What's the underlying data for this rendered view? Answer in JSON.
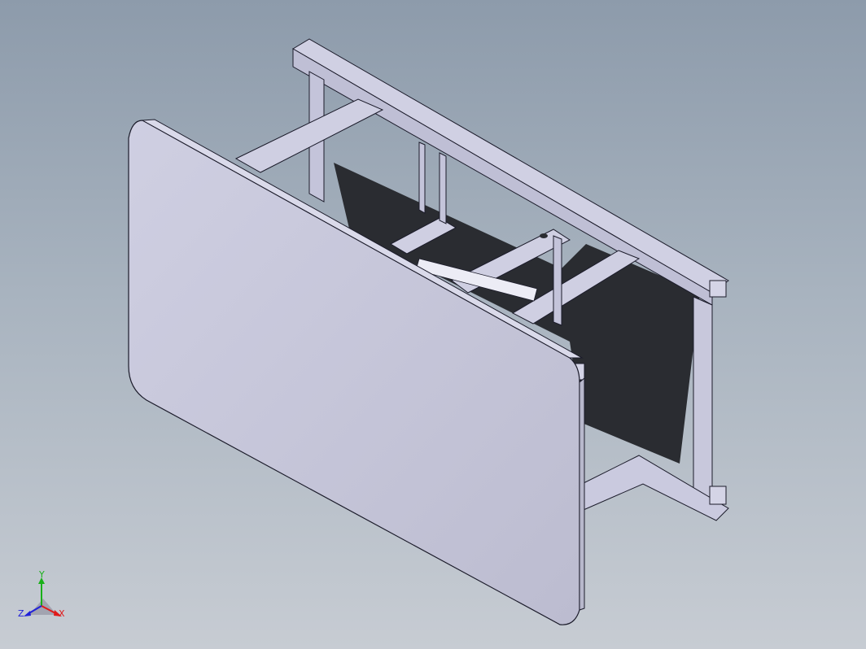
{
  "view": {
    "background_top": "#8d9bab",
    "background_bottom": "#c7ccd3",
    "part_fill": "#c7c7dc",
    "part_edge": "#1b1b2a",
    "shadow": "#26282d"
  },
  "triad": {
    "x_label": "X",
    "y_label": "Y",
    "z_label": "Z",
    "x_color": "#e01a1a",
    "y_color": "#19b019",
    "z_color": "#2020d8"
  }
}
